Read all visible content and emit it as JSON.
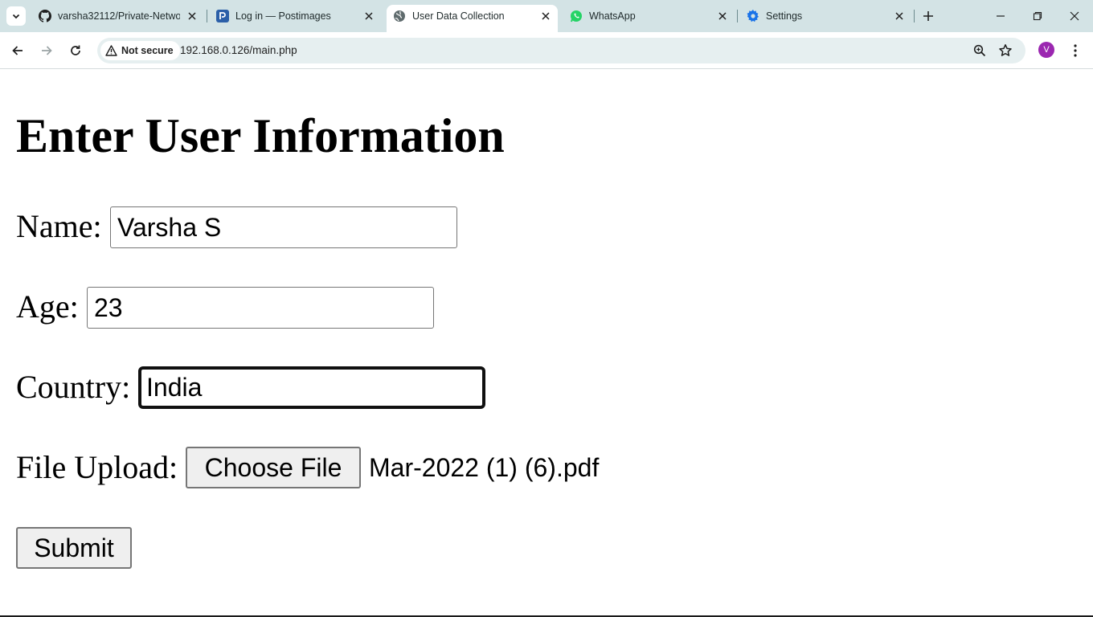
{
  "browser": {
    "tabs": [
      {
        "title": "varsha32112/Private-Networ",
        "icon": "github-icon"
      },
      {
        "title": "Log in — Postimages",
        "icon": "postimages-icon"
      },
      {
        "title": "User Data Collection",
        "icon": "globe-icon",
        "active": true
      },
      {
        "title": "WhatsApp",
        "icon": "whatsapp-icon"
      },
      {
        "title": "Settings",
        "icon": "gear-icon"
      }
    ],
    "security_label": "Not secure",
    "url": "192.168.0.126/main.php",
    "profile_initial": "V",
    "colors": {
      "tabstrip": "#d3e3e5",
      "omnibox": "#e6eff0",
      "avatar": "#9b27b0",
      "whatsapp": "#25d366",
      "settings": "#1a73e8"
    }
  },
  "form": {
    "title": "Enter User Information",
    "name_label": "Name:",
    "name_value": "Varsha S",
    "age_label": "Age:",
    "age_value": "23",
    "country_label": "Country:",
    "country_value": "India",
    "file_label": "File Upload:",
    "choose_file_label": "Choose File",
    "file_name": "Mar-2022 (1) (6).pdf",
    "submit_label": "Submit"
  }
}
